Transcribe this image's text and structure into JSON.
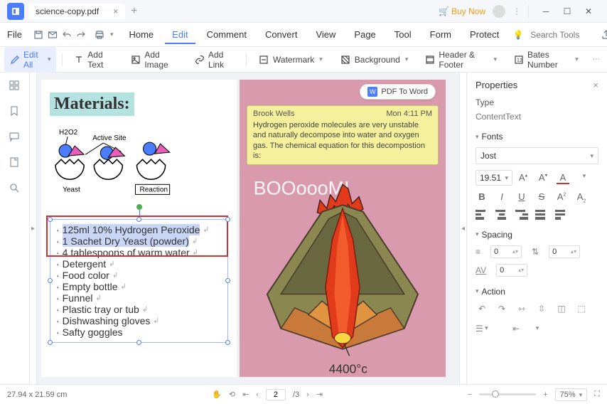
{
  "titlebar": {
    "filename": "science-copy.pdf",
    "buy_now": "Buy Now"
  },
  "menubar": {
    "file": "File",
    "items": [
      "Home",
      "Edit",
      "Comment",
      "Convert",
      "View",
      "Page",
      "Tool",
      "Form",
      "Protect"
    ],
    "search_placeholder": "Search Tools"
  },
  "toolbar": {
    "edit_all": "Edit All",
    "add_text": "Add Text",
    "add_image": "Add Image",
    "add_link": "Add Link",
    "watermark": "Watermark",
    "background": "Background",
    "header_footer": "Header & Footer",
    "bates": "Bates Number"
  },
  "document": {
    "materials_heading": "Materials:",
    "diagram_labels": {
      "h2o2": "H2O2",
      "active_site": "Active Site",
      "yeast": "Yeast",
      "reaction": "Reaction"
    },
    "list": [
      "125ml 10% Hydrogen Peroxide",
      "1 Sachet Dry Yeast (powder)",
      "4 tablespoons of warm water",
      "Detergent",
      "Food color",
      "Empty bottle",
      "Funnel",
      "Plastic tray or tub",
      "Dishwashing gloves",
      "Safty goggles"
    ],
    "boom_text": "BOOoooM!",
    "temp_label": "4400°c"
  },
  "pdf_to_word": "PDF To Word",
  "note": {
    "author": "Brook Wells",
    "time": "Mon 4:11 PM",
    "body": "Hydrogen peroxide molecules are very unstable and naturally decompose into water and oxygen gas. The chemical equation for this decompostion is:"
  },
  "properties": {
    "title": "Properties",
    "type_label": "Type",
    "type_value": "ContentText",
    "fonts_label": "Fonts",
    "font_family": "Jost",
    "font_size": "19.51",
    "spacing_label": "Spacing",
    "spacing_line": "0",
    "spacing_para": "0",
    "spacing_char": "0",
    "action_label": "Action"
  },
  "statusbar": {
    "dimensions": "27.94 x 21.59 cm",
    "page_current": "2",
    "page_total": "/3",
    "zoom": "75%"
  }
}
